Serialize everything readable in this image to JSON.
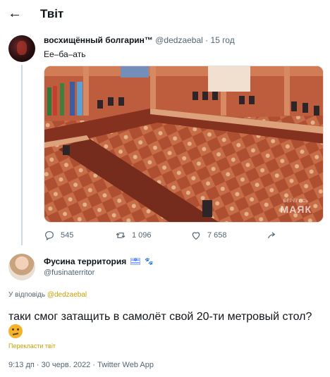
{
  "header": {
    "title": "Твіт",
    "back_icon": "arrow-left-icon"
  },
  "tweet1": {
    "name": "восхищённый болгарин™",
    "handle": "@dedzaebal",
    "dot": "·",
    "time": "15 год",
    "text": "Ее–ба–ать",
    "media": {
      "watermark_top": "БЕРЕГИСЬ",
      "watermark_big": "МАЯК"
    },
    "actions": {
      "reply_count": "545",
      "retweet_count": "1 096",
      "like_count": "7 658"
    }
  },
  "tweet2": {
    "name": "Фусина территория",
    "handle": "@fusinaterritor",
    "reply_prefix": "У відповідь",
    "reply_to": "@dedzaebal",
    "text": "таки смог затащить в самолёт свой 20-ти метровый стол?",
    "translate": "Перекласти твіт",
    "meta": "9:13 дп · 30 черв. 2022 · Twitter Web App"
  },
  "colors": {
    "accent_link": "#c8a000",
    "muted": "#536471",
    "text": "#0f1419"
  }
}
